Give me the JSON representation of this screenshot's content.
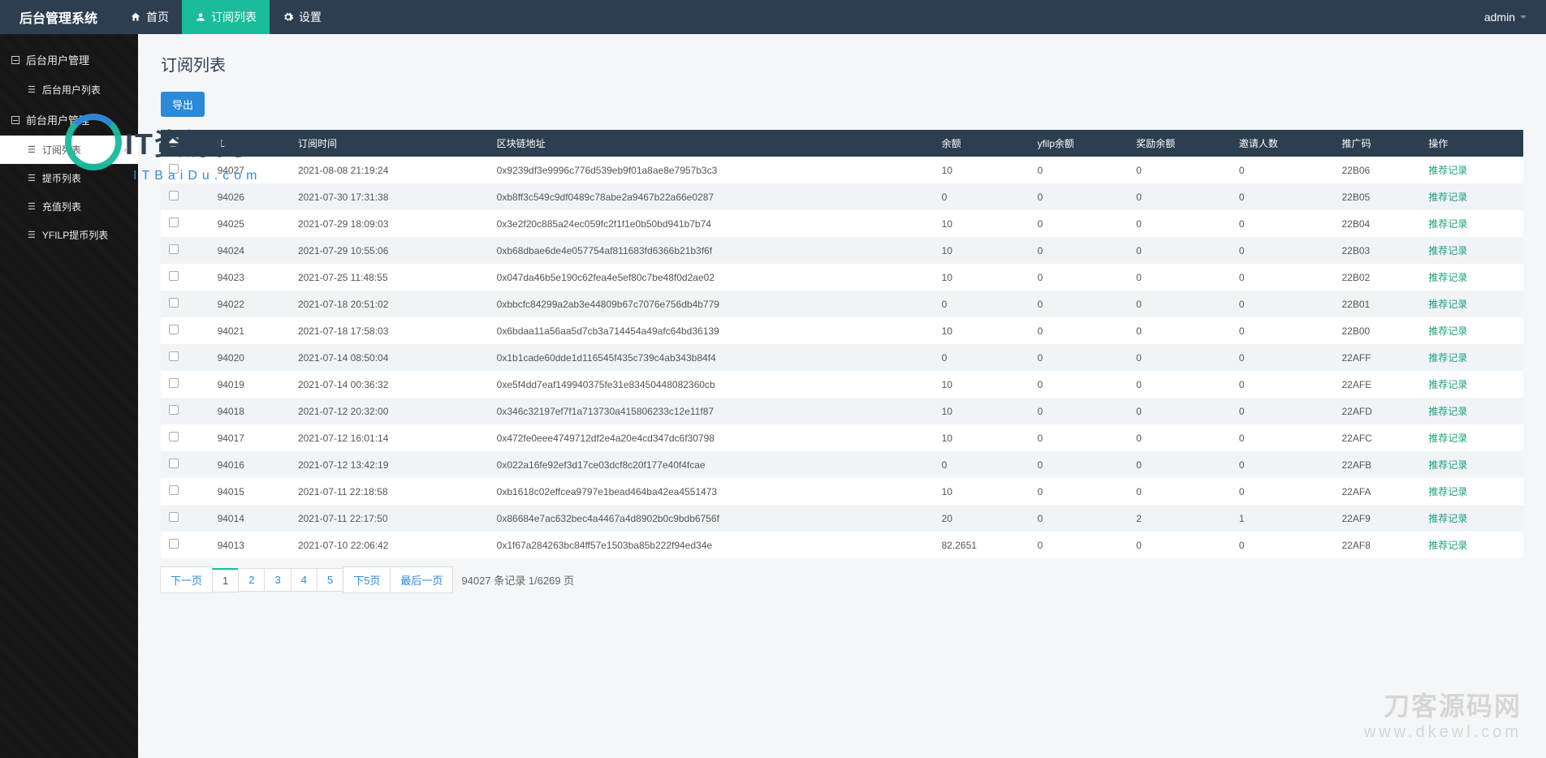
{
  "brand": "后台管理系统",
  "topnav": {
    "home": "首页",
    "subscribe": "订阅列表",
    "settings": "设置"
  },
  "user": {
    "name": "admin"
  },
  "sidebar": {
    "group1": {
      "title": "后台用户管理",
      "items": [
        {
          "label": "后台用户列表"
        }
      ]
    },
    "group2": {
      "title": "前台用户管理",
      "items": [
        {
          "label": "订阅列表",
          "active": true
        },
        {
          "label": "提币列表"
        },
        {
          "label": "充值列表"
        },
        {
          "label": "YFILP提币列表"
        }
      ]
    }
  },
  "page": {
    "title": "订阅列表",
    "export_btn": "导出"
  },
  "table": {
    "headers": [
      "",
      "ID",
      "订阅时间",
      "区块链地址",
      "余额",
      "yfilp余额",
      "奖励余额",
      "邀请人数",
      "推广码",
      "操作"
    ],
    "action_label": "推荐记录",
    "rows": [
      {
        "id": "94027",
        "time": "2021-08-08 21:19:24",
        "addr": "0x9239df3e9996c776d539eb9f01a8ae8e7957b3c3",
        "bal": "10",
        "yfilp": "0",
        "reward": "0",
        "invite": "0",
        "code": "22B06"
      },
      {
        "id": "94026",
        "time": "2021-07-30 17:31:38",
        "addr": "0xb8ff3c549c9df0489c78abe2a9467b22a66e0287",
        "bal": "0",
        "yfilp": "0",
        "reward": "0",
        "invite": "0",
        "code": "22B05"
      },
      {
        "id": "94025",
        "time": "2021-07-29 18:09:03",
        "addr": "0x3e2f20c885a24ec059fc2f1f1e0b50bd941b7b74",
        "bal": "10",
        "yfilp": "0",
        "reward": "0",
        "invite": "0",
        "code": "22B04"
      },
      {
        "id": "94024",
        "time": "2021-07-29 10:55:06",
        "addr": "0xb68dbae6de4e057754af811683fd6366b21b3f6f",
        "bal": "10",
        "yfilp": "0",
        "reward": "0",
        "invite": "0",
        "code": "22B03"
      },
      {
        "id": "94023",
        "time": "2021-07-25 11:48:55",
        "addr": "0x047da46b5e190c62fea4e5ef80c7be48f0d2ae02",
        "bal": "10",
        "yfilp": "0",
        "reward": "0",
        "invite": "0",
        "code": "22B02"
      },
      {
        "id": "94022",
        "time": "2021-07-18 20:51:02",
        "addr": "0xbbcfc84299a2ab3e44809b67c7076e756db4b779",
        "bal": "0",
        "yfilp": "0",
        "reward": "0",
        "invite": "0",
        "code": "22B01"
      },
      {
        "id": "94021",
        "time": "2021-07-18 17:58:03",
        "addr": "0x6bdaa11a56aa5d7cb3a714454a49afc64bd36139",
        "bal": "10",
        "yfilp": "0",
        "reward": "0",
        "invite": "0",
        "code": "22B00"
      },
      {
        "id": "94020",
        "time": "2021-07-14 08:50:04",
        "addr": "0x1b1cade60dde1d116545f435c739c4ab343b84f4",
        "bal": "0",
        "yfilp": "0",
        "reward": "0",
        "invite": "0",
        "code": "22AFF"
      },
      {
        "id": "94019",
        "time": "2021-07-14 00:36:32",
        "addr": "0xe5f4dd7eaf149940375fe31e83450448082360cb",
        "bal": "10",
        "yfilp": "0",
        "reward": "0",
        "invite": "0",
        "code": "22AFE"
      },
      {
        "id": "94018",
        "time": "2021-07-12 20:32:00",
        "addr": "0x346c32197ef7f1a713730a415806233c12e11f87",
        "bal": "10",
        "yfilp": "0",
        "reward": "0",
        "invite": "0",
        "code": "22AFD"
      },
      {
        "id": "94017",
        "time": "2021-07-12 16:01:14",
        "addr": "0x472fe0eee4749712df2e4a20e4cd347dc6f30798",
        "bal": "10",
        "yfilp": "0",
        "reward": "0",
        "invite": "0",
        "code": "22AFC"
      },
      {
        "id": "94016",
        "time": "2021-07-12 13:42:19",
        "addr": "0x022a16fe92ef3d17ce03dcf8c20f177e40f4fcae",
        "bal": "0",
        "yfilp": "0",
        "reward": "0",
        "invite": "0",
        "code": "22AFB"
      },
      {
        "id": "94015",
        "time": "2021-07-11 22:18:58",
        "addr": "0xb1618c02effcea9797e1bead464ba42ea4551473",
        "bal": "10",
        "yfilp": "0",
        "reward": "0",
        "invite": "0",
        "code": "22AFA"
      },
      {
        "id": "94014",
        "time": "2021-07-11 22:17:50",
        "addr": "0x86684e7ac632bec4a4467a4d8902b0c9bdb6756f",
        "bal": "20",
        "yfilp": "0",
        "reward": "2",
        "invite": "1",
        "code": "22AF9"
      },
      {
        "id": "94013",
        "time": "2021-07-10 22:06:42",
        "addr": "0x1f67a284263bc84ff57e1503ba85b222f94ed34e",
        "bal": "82.2651",
        "yfilp": "0",
        "reward": "0",
        "invite": "0",
        "code": "22AF8"
      }
    ]
  },
  "pager": {
    "next": "下一页",
    "pages": [
      "1",
      "2",
      "3",
      "4",
      "5"
    ],
    "next5": "下5页",
    "last": "最后一页",
    "info": "94027 条记录 1/6269 页"
  },
  "watermark1": {
    "main": "IT资源网",
    "sub": "ITBaiDu.com"
  },
  "watermark2": {
    "l1": "刀客源码网",
    "l2": "www.dkewl.com"
  }
}
